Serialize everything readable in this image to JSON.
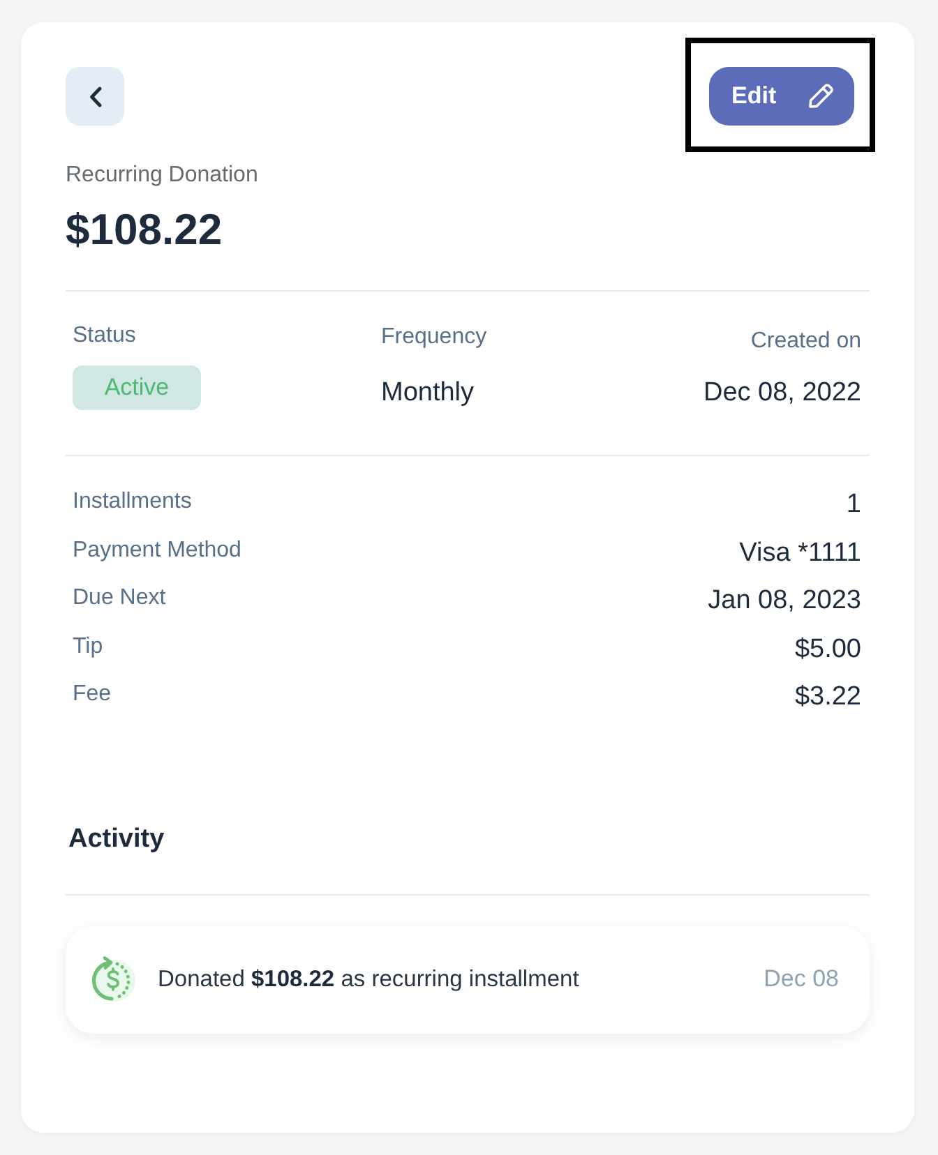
{
  "header": {
    "edit_button": {
      "label": "Edit",
      "highlighted": true
    }
  },
  "donation": {
    "label": "Recurring Donation",
    "amount": "$108.22"
  },
  "summary": {
    "status": {
      "label": "Status",
      "value": "Active"
    },
    "frequency": {
      "label": "Frequency",
      "value": "Monthly"
    },
    "created": {
      "label": "Created on",
      "value": "Dec 08, 2022"
    }
  },
  "details": [
    {
      "label": "Installments",
      "value": "1"
    },
    {
      "label": "Payment Method",
      "value": "Visa *1111"
    },
    {
      "label": "Due Next",
      "value": "Jan 08, 2023"
    },
    {
      "label": "Tip",
      "value": "$5.00"
    },
    {
      "label": "Fee",
      "value": "$3.22"
    }
  ],
  "activity": {
    "title": "Activity",
    "items": [
      {
        "text": "Donated **$108.22** as recurring installment",
        "date": "Dec 08"
      }
    ]
  }
}
